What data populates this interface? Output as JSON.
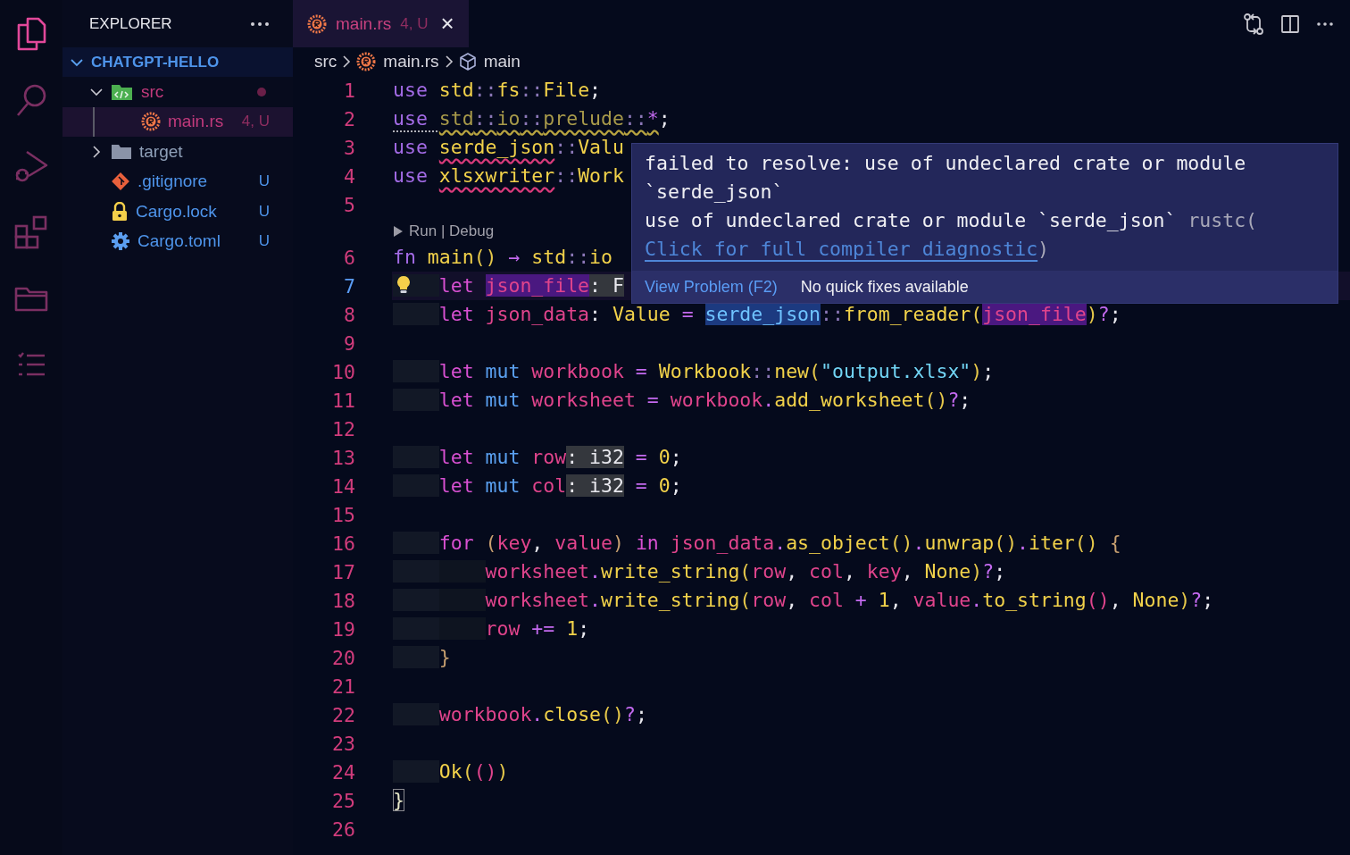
{
  "activity_bar": [
    {
      "kind": "files",
      "selected": true
    },
    {
      "kind": "search",
      "selected": false
    },
    {
      "kind": "debug",
      "selected": false
    },
    {
      "kind": "extensions",
      "selected": false
    },
    {
      "kind": "folder",
      "selected": false
    },
    {
      "kind": "list",
      "selected": false
    }
  ],
  "explorer": {
    "title": "EXPLORER",
    "project": {
      "label": "CHATGPT-HELLO",
      "expanded": true
    },
    "items": [
      {
        "label": "src",
        "kind": "src-folder",
        "expanded": true,
        "error": true,
        "selected": false,
        "children": [
          {
            "label": "main.rs",
            "kind": "rust",
            "error": true,
            "badge": "4, U",
            "selected": true
          }
        ]
      },
      {
        "label": "target",
        "kind": "folder",
        "expanded": false,
        "error": false,
        "untracked": false,
        "selected": false
      },
      {
        "label": ".gitignore",
        "kind": "git",
        "error": false,
        "untracked": true,
        "badge": "U",
        "selected": false
      },
      {
        "label": "Cargo.lock",
        "kind": "lock",
        "error": false,
        "untracked": true,
        "badge": "U",
        "selected": false
      },
      {
        "label": "Cargo.toml",
        "kind": "gear",
        "error": false,
        "untracked": true,
        "badge": "U",
        "selected": false
      }
    ]
  },
  "tabs": [
    {
      "label": "main.rs",
      "badge": "4, U",
      "close": "×",
      "selected": true
    }
  ],
  "breadcrumb": [
    {
      "label": "src",
      "kind": "folder"
    },
    {
      "label": "main.rs",
      "kind": "rust"
    },
    {
      "label": "main",
      "kind": "symbol"
    }
  ],
  "lines": [
    {
      "kind": "code",
      "number": "1",
      "current": false,
      "tokens": [
        {
          "text": "use ",
          "kind": "kw"
        },
        {
          "text": "std",
          "kind": "type"
        },
        {
          "text": "::",
          "kind": "sep"
        },
        {
          "text": "fs",
          "kind": "type"
        },
        {
          "text": "::",
          "kind": "sep"
        },
        {
          "text": "File",
          "kind": "type"
        },
        {
          "text": ";",
          "kind": "punct"
        }
      ]
    },
    {
      "kind": "code",
      "number": "2",
      "current": false,
      "tokens": [
        {
          "text": "use ",
          "kind": "kw",
          "hint": true
        },
        {
          "text": "std",
          "kind": "dim",
          "warning": true
        },
        {
          "text": "::",
          "kind": "sep",
          "warning": true
        },
        {
          "text": "io",
          "kind": "dim",
          "warning": true
        },
        {
          "text": "::",
          "kind": "sep",
          "warning": true
        },
        {
          "text": "prelude",
          "kind": "dim",
          "warning": true
        },
        {
          "text": "::",
          "kind": "sep",
          "warning": true
        },
        {
          "text": "*",
          "kind": "op",
          "warning": true
        },
        {
          "text": ";",
          "kind": "punct"
        }
      ]
    },
    {
      "kind": "code",
      "number": "3",
      "current": false,
      "tokens": [
        {
          "text": "use ",
          "kind": "kw"
        },
        {
          "text": "serde_json",
          "kind": "type",
          "error": true
        },
        {
          "text": "::",
          "kind": "sep"
        },
        {
          "text": "Valu",
          "kind": "type"
        }
      ]
    },
    {
      "kind": "code",
      "number": "4",
      "current": false,
      "tokens": [
        {
          "text": "use ",
          "kind": "kw"
        },
        {
          "text": "xlsxwriter",
          "kind": "type",
          "error": true
        },
        {
          "text": "::",
          "kind": "sep"
        },
        {
          "text": "Work",
          "kind": "type"
        }
      ]
    },
    {
      "kind": "code",
      "number": "5",
      "current": false
    },
    {
      "kind": "codelens",
      "text": "Run | Debug"
    },
    {
      "kind": "code",
      "number": "6",
      "current": false,
      "tokens": [
        {
          "text": "fn ",
          "kind": "kw"
        },
        {
          "text": "main",
          "kind": "type"
        },
        {
          "text": "()",
          "kind": "paren"
        },
        {
          "text": " → ",
          "kind": "op"
        },
        {
          "text": "std",
          "kind": "type"
        },
        {
          "text": "::",
          "kind": "sep"
        },
        {
          "text": "io",
          "kind": "type"
        }
      ]
    },
    {
      "kind": "code",
      "number": "7",
      "current": true,
      "tokens": [
        {
          "text": "    let ",
          "kind": "storage"
        },
        {
          "text": "json_file",
          "kind": "hl"
        },
        {
          "text": ": F",
          "kind": "inlay"
        }
      ]
    },
    {
      "kind": "code",
      "number": "8",
      "current": false,
      "tokens": [
        {
          "text": "    let ",
          "kind": "storage"
        },
        {
          "text": "json_data",
          "kind": "var"
        },
        {
          "text": ": ",
          "kind": "punct"
        },
        {
          "text": "Value",
          "kind": "type"
        },
        {
          "text": " = ",
          "kind": "op"
        },
        {
          "text": "serde_json",
          "kind": "sel"
        },
        {
          "text": "::",
          "kind": "sep"
        },
        {
          "text": "from_reader",
          "kind": "type"
        },
        {
          "text": "(",
          "kind": "paren"
        },
        {
          "text": "json_file",
          "kind": "hl"
        },
        {
          "text": ")",
          "kind": "paren"
        },
        {
          "text": "?",
          "kind": "op"
        },
        {
          "text": ";",
          "kind": "punct"
        }
      ]
    },
    {
      "kind": "code",
      "number": "9",
      "current": false
    },
    {
      "kind": "code",
      "number": "10",
      "current": false,
      "tokens": [
        {
          "text": "    let ",
          "kind": "storage"
        },
        {
          "text": "mut ",
          "kind": "mut"
        },
        {
          "text": "workbook",
          "kind": "var"
        },
        {
          "text": " = ",
          "kind": "op"
        },
        {
          "text": "Workbook",
          "kind": "type"
        },
        {
          "text": "::",
          "kind": "sep"
        },
        {
          "text": "new",
          "kind": "type"
        },
        {
          "text": "(",
          "kind": "paren"
        },
        {
          "text": "\"output.xlsx\"",
          "kind": "string"
        },
        {
          "text": ")",
          "kind": "paren"
        },
        {
          "text": ";",
          "kind": "punct"
        }
      ]
    },
    {
      "kind": "code",
      "number": "11",
      "current": false,
      "tokens": [
        {
          "text": "    let ",
          "kind": "storage"
        },
        {
          "text": "mut ",
          "kind": "mut"
        },
        {
          "text": "worksheet",
          "kind": "var"
        },
        {
          "text": " = ",
          "kind": "op"
        },
        {
          "text": "workbook",
          "kind": "var"
        },
        {
          "text": ".",
          "kind": "op"
        },
        {
          "text": "add_worksheet",
          "kind": "type"
        },
        {
          "text": "()",
          "kind": "paren"
        },
        {
          "text": "?",
          "kind": "op"
        },
        {
          "text": ";",
          "kind": "punct"
        }
      ]
    },
    {
      "kind": "code",
      "number": "12",
      "current": false
    },
    {
      "kind": "code",
      "number": "13",
      "current": false,
      "tokens": [
        {
          "text": "    let ",
          "kind": "storage"
        },
        {
          "text": "mut ",
          "kind": "mut"
        },
        {
          "text": "row",
          "kind": "var"
        },
        {
          "text": ": i32",
          "kind": "inlay"
        },
        {
          "text": " = ",
          "kind": "op"
        },
        {
          "text": "0",
          "kind": "type"
        },
        {
          "text": ";",
          "kind": "punct"
        }
      ]
    },
    {
      "kind": "code",
      "number": "14",
      "current": false,
      "tokens": [
        {
          "text": "    let ",
          "kind": "storage"
        },
        {
          "text": "mut ",
          "kind": "mut"
        },
        {
          "text": "col",
          "kind": "var"
        },
        {
          "text": ": i32",
          "kind": "inlay"
        },
        {
          "text": " = ",
          "kind": "op"
        },
        {
          "text": "0",
          "kind": "type"
        },
        {
          "text": ";",
          "kind": "punct"
        }
      ]
    },
    {
      "kind": "code",
      "number": "15",
      "current": false
    },
    {
      "kind": "code",
      "number": "16",
      "current": false,
      "tokens": [
        {
          "text": "    for ",
          "kind": "storage"
        },
        {
          "text": "(",
          "kind": "brace"
        },
        {
          "text": "key",
          "kind": "var"
        },
        {
          "text": ", ",
          "kind": "punct"
        },
        {
          "text": "value",
          "kind": "var"
        },
        {
          "text": ")",
          "kind": "brace"
        },
        {
          "text": " in ",
          "kind": "storage"
        },
        {
          "text": "json_data",
          "kind": "var"
        },
        {
          "text": ".",
          "kind": "op"
        },
        {
          "text": "as_object",
          "kind": "type"
        },
        {
          "text": "()",
          "kind": "paren"
        },
        {
          "text": ".",
          "kind": "op"
        },
        {
          "text": "unwrap",
          "kind": "type"
        },
        {
          "text": "()",
          "kind": "paren"
        },
        {
          "text": ".",
          "kind": "op"
        },
        {
          "text": "iter",
          "kind": "type"
        },
        {
          "text": "()",
          "kind": "paren"
        },
        {
          "text": " {",
          "kind": "brace"
        }
      ]
    },
    {
      "kind": "code",
      "number": "17",
      "current": false,
      "tokens": [
        {
          "text": "        worksheet",
          "kind": "var"
        },
        {
          "text": ".",
          "kind": "op"
        },
        {
          "text": "write_string",
          "kind": "type"
        },
        {
          "text": "(",
          "kind": "paren"
        },
        {
          "text": "row",
          "kind": "var"
        },
        {
          "text": ", ",
          "kind": "punct"
        },
        {
          "text": "col",
          "kind": "var"
        },
        {
          "text": ", ",
          "kind": "punct"
        },
        {
          "text": "key",
          "kind": "var"
        },
        {
          "text": ", ",
          "kind": "punct"
        },
        {
          "text": "None",
          "kind": "type"
        },
        {
          "text": ")",
          "kind": "paren"
        },
        {
          "text": "?",
          "kind": "op"
        },
        {
          "text": ";",
          "kind": "punct"
        }
      ]
    },
    {
      "kind": "code",
      "number": "18",
      "current": false,
      "tokens": [
        {
          "text": "        worksheet",
          "kind": "var"
        },
        {
          "text": ".",
          "kind": "op"
        },
        {
          "text": "write_string",
          "kind": "type"
        },
        {
          "text": "(",
          "kind": "paren"
        },
        {
          "text": "row",
          "kind": "var"
        },
        {
          "text": ", ",
          "kind": "punct"
        },
        {
          "text": "col",
          "kind": "var"
        },
        {
          "text": " + ",
          "kind": "op"
        },
        {
          "text": "1",
          "kind": "type"
        },
        {
          "text": ", ",
          "kind": "punct"
        },
        {
          "text": "value",
          "kind": "var"
        },
        {
          "text": ".",
          "kind": "op"
        },
        {
          "text": "to_string",
          "kind": "type"
        },
        {
          "text": "()",
          "kind": "var"
        },
        {
          "text": ", ",
          "kind": "punct"
        },
        {
          "text": "None",
          "kind": "type"
        },
        {
          "text": ")",
          "kind": "paren"
        },
        {
          "text": "?",
          "kind": "op"
        },
        {
          "text": ";",
          "kind": "punct"
        }
      ]
    },
    {
      "kind": "code",
      "number": "19",
      "current": false,
      "tokens": [
        {
          "text": "        row",
          "kind": "var"
        },
        {
          "text": " += ",
          "kind": "op"
        },
        {
          "text": "1",
          "kind": "type"
        },
        {
          "text": ";",
          "kind": "punct"
        }
      ]
    },
    {
      "kind": "code",
      "number": "20",
      "current": false,
      "tokens": [
        {
          "text": "    }",
          "kind": "brace"
        }
      ]
    },
    {
      "kind": "code",
      "number": "21",
      "current": false
    },
    {
      "kind": "code",
      "number": "22",
      "current": false,
      "tokens": [
        {
          "text": "    workbook",
          "kind": "var"
        },
        {
          "text": ".",
          "kind": "op"
        },
        {
          "text": "close",
          "kind": "type"
        },
        {
          "text": "()",
          "kind": "paren"
        },
        {
          "text": "?",
          "kind": "op"
        },
        {
          "text": ";",
          "kind": "punct"
        }
      ]
    },
    {
      "kind": "code",
      "number": "23",
      "current": false
    },
    {
      "kind": "code",
      "number": "24",
      "current": false,
      "tokens": [
        {
          "text": "    Ok",
          "kind": "type"
        },
        {
          "text": "(",
          "kind": "paren"
        },
        {
          "text": "()",
          "kind": "var"
        },
        {
          "text": ")",
          "kind": "paren"
        }
      ]
    },
    {
      "kind": "code",
      "number": "25",
      "current": false,
      "tokens": [
        {
          "text": "}",
          "kind": "match"
        }
      ]
    },
    {
      "kind": "code",
      "number": "26",
      "current": false
    }
  ],
  "hover": {
    "message": "failed to resolve: use of undeclared crate or module `serde_json`",
    "detail": "use of undeclared crate or module `serde_json` ",
    "source": "rustc(",
    "link": "Click for full compiler diagnostic",
    "close_paren": ")",
    "action": "View Problem (F2)",
    "note": "No quick fixes available"
  }
}
